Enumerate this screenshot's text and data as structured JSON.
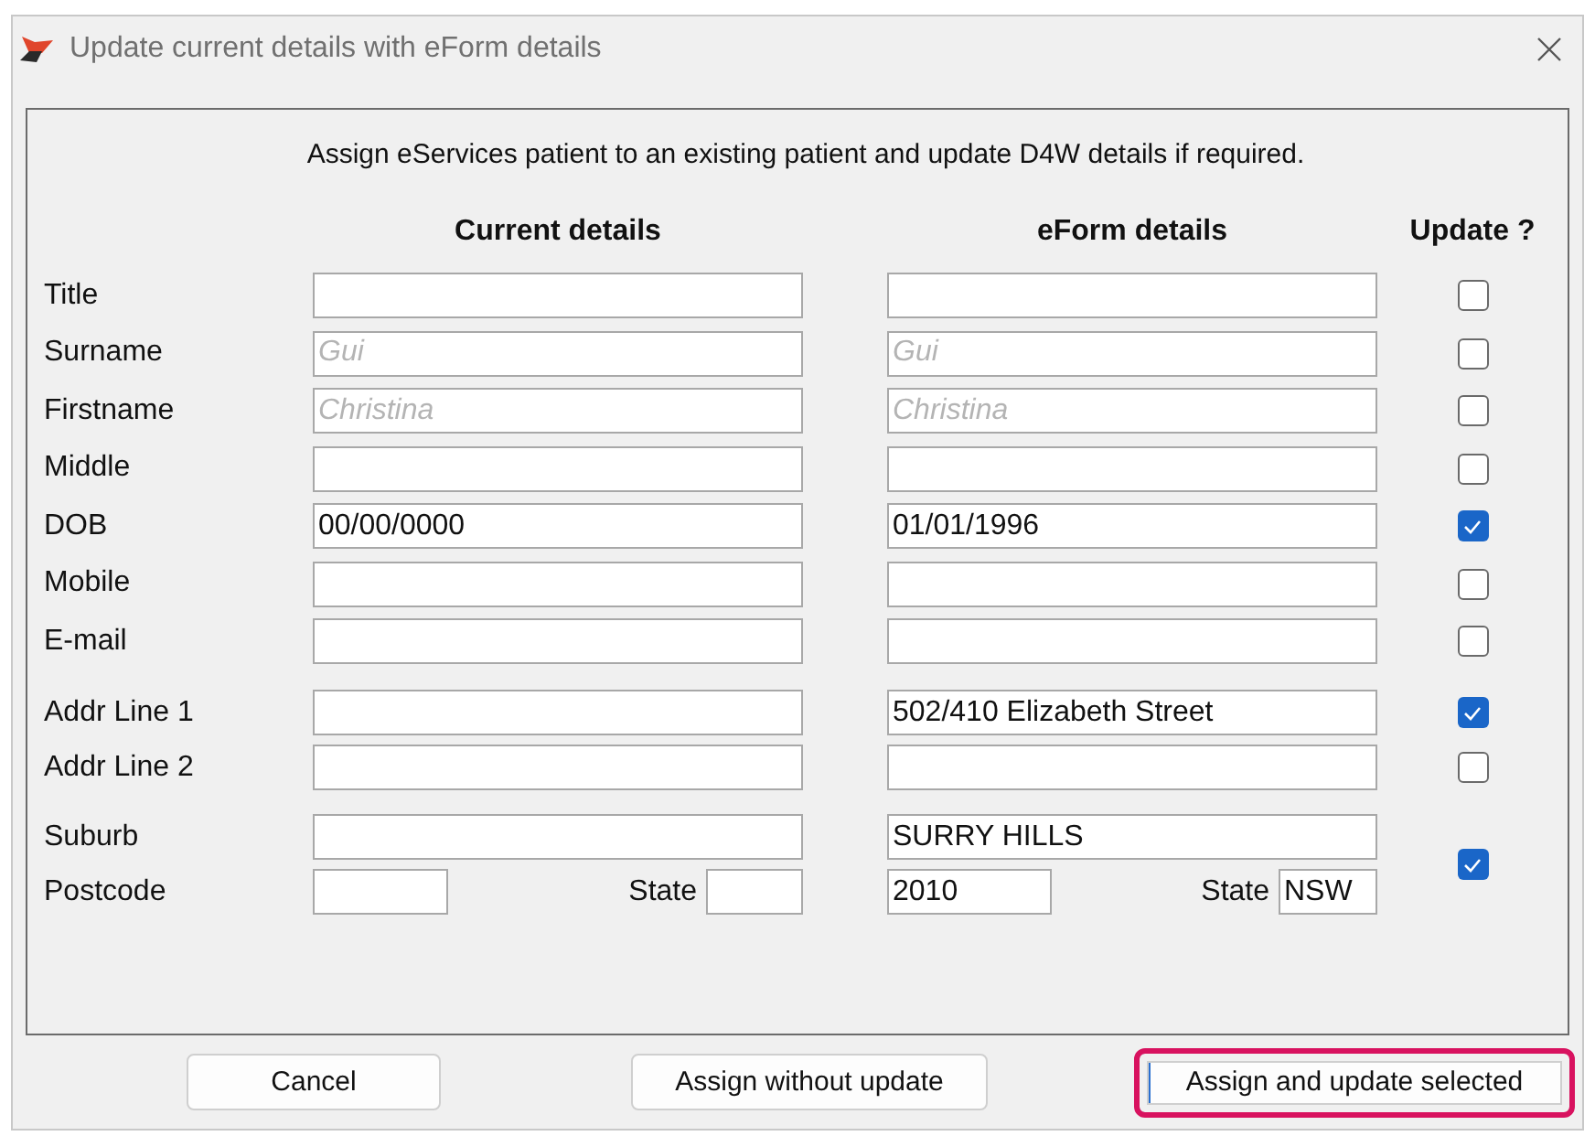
{
  "window": {
    "title": "Update current details with eForm details"
  },
  "instruction": "Assign eServices patient to an existing patient and update D4W details if required.",
  "headers": {
    "current": "Current details",
    "eform": "eForm details",
    "update": "Update ?"
  },
  "groups": [
    {
      "kind": "separate",
      "fields": [
        {
          "label": "Title",
          "update": false
        },
        {
          "label": "Surname",
          "current": {
            "placeholder": "Gui"
          },
          "eform": {
            "placeholder": "Gui"
          },
          "update": false
        },
        {
          "label": "Firstname",
          "current": {
            "placeholder": "Christina"
          },
          "eform": {
            "placeholder": "Christina"
          },
          "update": false
        },
        {
          "label": "Middle",
          "update": false
        },
        {
          "label": "DOB",
          "current": {
            "value": "00/00/0000"
          },
          "eform": {
            "value": "01/01/1996"
          },
          "update": true
        },
        {
          "label": "Mobile",
          "update": false
        },
        {
          "label": "E-mail",
          "update": false
        }
      ]
    },
    {
      "kind": "separate",
      "fields": [
        {
          "label": "Addr Line 1",
          "eform": {
            "value": "502/410 Elizabeth Street"
          },
          "update": true
        },
        {
          "label": "Addr Line 2",
          "update": false
        }
      ]
    },
    {
      "kind": "shared",
      "update": true,
      "fields": [
        {
          "kind": "text",
          "label": "Suburb",
          "eform": {
            "value": "SURRY HILLS"
          }
        },
        {
          "kind": "postcode",
          "label": "Postcode",
          "current": {
            "state_label": "State"
          },
          "eform": {
            "value": "2010",
            "state_label": "State",
            "state": "NSW"
          }
        }
      ]
    }
  ],
  "buttons": [
    {
      "label": "Cancel",
      "highlighted": false
    },
    {
      "label": "Assign without update",
      "highlighted": false
    },
    {
      "label": "Assign and update selected",
      "highlighted": true
    }
  ]
}
